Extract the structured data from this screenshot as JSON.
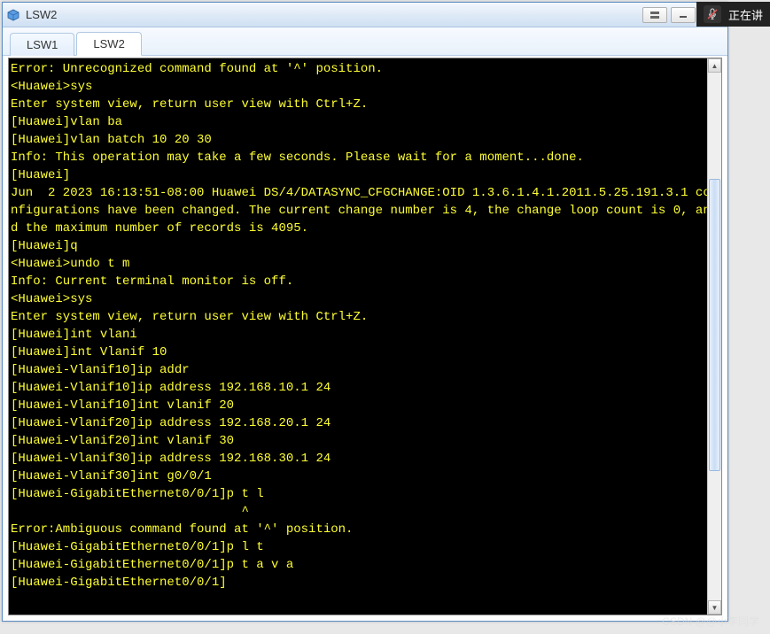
{
  "window": {
    "title": "LSW2"
  },
  "tabs": [
    {
      "label": "LSW1",
      "active": false
    },
    {
      "label": "LSW2",
      "active": true
    }
  ],
  "overlay": {
    "label": "正在讲"
  },
  "watermark": "CSDN @@小李同学",
  "terminal": {
    "lines": [
      "Error: Unrecognized command found at '^' position.",
      "<Huawei>sys",
      "Enter system view, return user view with Ctrl+Z.",
      "[Huawei]vlan ba",
      "[Huawei]vlan batch 10 20 30",
      "Info: This operation may take a few seconds. Please wait for a moment...done.",
      "[Huawei]",
      "Jun  2 2023 16:13:51-08:00 Huawei DS/4/DATASYNC_CFGCHANGE:OID 1.3.6.1.4.1.2011.5.25.191.3.1 configurations have been changed. The current change number is 4, the change loop count is 0, and the maximum number of records is 4095.",
      "[Huawei]q",
      "<Huawei>undo t m",
      "Info: Current terminal monitor is off.",
      "<Huawei>sys",
      "Enter system view, return user view with Ctrl+Z.",
      "[Huawei]int vlani",
      "[Huawei]int Vlanif 10",
      "[Huawei-Vlanif10]ip addr",
      "[Huawei-Vlanif10]ip address 192.168.10.1 24",
      "[Huawei-Vlanif10]int vlanif 20",
      "[Huawei-Vlanif20]ip address 192.168.20.1 24",
      "[Huawei-Vlanif20]int vlanif 30",
      "[Huawei-Vlanif30]ip address 192.168.30.1 24",
      "[Huawei-Vlanif30]int g0/0/1",
      "[Huawei-GigabitEthernet0/0/1]p t l",
      "CARET30",
      "Error:Ambiguous command found at '^' position.",
      "[Huawei-GigabitEthernet0/0/1]p l t",
      "[Huawei-GigabitEthernet0/0/1]p t a v a",
      "[Huawei-GigabitEthernet0/0/1]"
    ]
  }
}
